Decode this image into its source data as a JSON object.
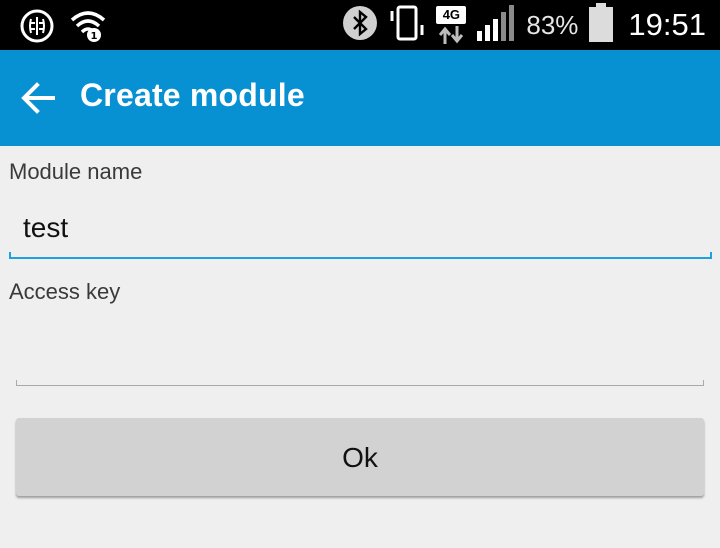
{
  "status_bar": {
    "icons_left": [
      "brain-app-icon",
      "wifi-icon"
    ],
    "icons_right": [
      "bluetooth-icon",
      "vibrate-icon",
      "network-4g-icon",
      "signal-icon",
      "battery-icon"
    ],
    "network_label": "4G",
    "battery_percent": "83%",
    "battery_level": 0.83,
    "time": "19:51"
  },
  "toolbar": {
    "title": "Create module",
    "back_icon": "arrow-left-icon",
    "color": "#0891d2"
  },
  "form": {
    "module_name": {
      "label": "Module name",
      "value": "test",
      "focused": true
    },
    "access_key": {
      "label": "Access key",
      "value": ""
    },
    "ok_button": {
      "label": "Ok"
    }
  },
  "colors": {
    "accent": "#1ea1e0",
    "background": "#efefef",
    "button": "#d2d2d2"
  }
}
